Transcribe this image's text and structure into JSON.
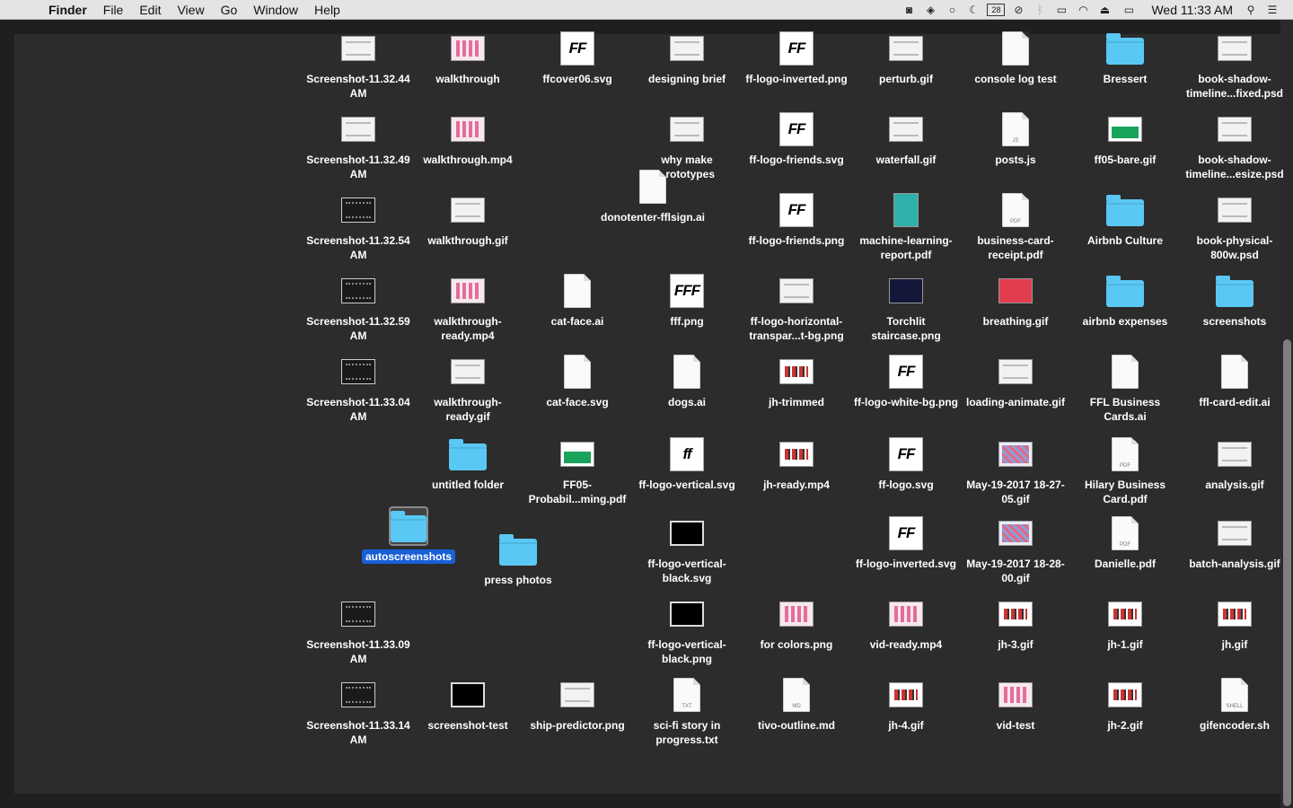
{
  "menubar": {
    "apple": "",
    "app_name": "Finder",
    "menus": [
      "File",
      "Edit",
      "View",
      "Go",
      "Window",
      "Help"
    ],
    "status_icons": [
      "camera-icon",
      "dropbox-icon",
      "record-icon",
      "moon-icon",
      "calendar-icon",
      "block-icon",
      "bluetooth-icon",
      "airplay-icon",
      "wifi-icon",
      "eject-icon",
      "battery-icon"
    ],
    "calendar_day": "28",
    "clock": "Wed 11:33 AM"
  },
  "desktop": {
    "items": [
      {
        "label": "Screenshot-11.32.44 AM",
        "icon": "thumb lined"
      },
      {
        "label": "walkthrough",
        "icon": "thumb pink"
      },
      {
        "label": "ffcover06.svg",
        "icon": "logo",
        "logo": "FF"
      },
      {
        "label": "designing brief",
        "icon": "thumb lined"
      },
      {
        "label": "ff-logo-inverted.png",
        "icon": "logo",
        "logo": "FF"
      },
      {
        "label": "perturb.gif",
        "icon": "thumb lined"
      },
      {
        "label": "console log test",
        "icon": "doc"
      },
      {
        "label": "Bressert",
        "icon": "folder"
      },
      {
        "label": "book-shadow-timeline...fixed.psd",
        "icon": "thumb lined"
      },
      {
        "label": "Screenshot-11.32.49 AM",
        "icon": "thumb lined"
      },
      {
        "label": "walkthrough.mp4",
        "icon": "thumb pink"
      },
      {
        "label": "why make prototypes",
        "icon": "thumb lined"
      },
      {
        "label": "ff-logo-friends.svg",
        "icon": "logo",
        "logo": "FF"
      },
      {
        "label": "waterfall.gif",
        "icon": "thumb lined"
      },
      {
        "label": "posts.js",
        "icon": "doc",
        "tag": "JS"
      },
      {
        "label": "ff05-bare.gif",
        "icon": "thumb green"
      },
      {
        "label": "book-shadow-timeline...esize.psd",
        "icon": "thumb lined"
      },
      {
        "label": "donotenter-fflsign.ai",
        "icon": "doc"
      },
      {
        "label": "Screenshot-11.32.54 AM",
        "icon": "thumb dark"
      },
      {
        "label": "walkthrough.gif",
        "icon": "thumb lined"
      },
      {
        "label": "ff-logo-friends.png",
        "icon": "logo",
        "logo": "FF"
      },
      {
        "label": "machine-learning-report.pdf",
        "icon": "thumb teal"
      },
      {
        "label": "business-card-receipt.pdf",
        "icon": "doc",
        "tag": "PDF"
      },
      {
        "label": "Airbnb Culture",
        "icon": "folder"
      },
      {
        "label": "book-physical-800w.psd",
        "icon": "thumb lined"
      },
      {
        "label": "Screenshot-11.32.59 AM",
        "icon": "thumb dark"
      },
      {
        "label": "walkthrough-ready.mp4",
        "icon": "thumb pink"
      },
      {
        "label": "cat-face.ai",
        "icon": "doc"
      },
      {
        "label": "fff.png",
        "icon": "logo",
        "logo": "FFF"
      },
      {
        "label": "ff-logo-horizontal-transpar...t-bg.png",
        "icon": "thumb lined"
      },
      {
        "label": "Torchlit staircase.png",
        "icon": "thumb navy"
      },
      {
        "label": "breathing.gif",
        "icon": "thumb red"
      },
      {
        "label": "airbnb expenses",
        "icon": "folder"
      },
      {
        "label": "screenshots",
        "icon": "folder"
      },
      {
        "label": "Screenshot-11.33.04 AM",
        "icon": "thumb dark"
      },
      {
        "label": "walkthrough-ready.gif",
        "icon": "thumb lined"
      },
      {
        "label": "cat-face.svg",
        "icon": "doc"
      },
      {
        "label": "dogs.ai",
        "icon": "doc"
      },
      {
        "label": "jh-trimmed",
        "icon": "thumb tiles"
      },
      {
        "label": "ff-logo-white-bg.png",
        "icon": "logo",
        "logo": "FF"
      },
      {
        "label": "loading-animate.gif",
        "icon": "thumb lined"
      },
      {
        "label": "FFL Business Cards.ai",
        "icon": "doc"
      },
      {
        "label": "ffl-card-edit.ai",
        "icon": "doc"
      },
      {
        "label": "untitled folder",
        "icon": "folder"
      },
      {
        "label": "FF05-Probabil...ming.pdf",
        "icon": "thumb green"
      },
      {
        "label": "ff-logo-vertical.svg",
        "icon": "logo",
        "logo": "ff"
      },
      {
        "label": "jh-ready.mp4",
        "icon": "thumb tiles"
      },
      {
        "label": "ff-logo.svg",
        "icon": "logo",
        "logo": "FF"
      },
      {
        "label": "May-19-2017 18-27-05.gif",
        "icon": "thumb pixel"
      },
      {
        "label": "Hilary Business Card.pdf",
        "icon": "doc",
        "tag": "PDF"
      },
      {
        "label": "analysis.gif",
        "icon": "thumb lined"
      },
      {
        "label": "autoscreenshots",
        "icon": "folder",
        "selected": true
      },
      {
        "label": "press photos",
        "icon": "folder"
      },
      {
        "label": "ff-logo-vertical-black.svg",
        "icon": "thumb black"
      },
      {
        "label": "ff-logo-inverted.svg",
        "icon": "logo",
        "logo": "FF"
      },
      {
        "label": "May-19-2017 18-28-00.gif",
        "icon": "thumb pixel"
      },
      {
        "label": "Danielle.pdf",
        "icon": "doc",
        "tag": "PDF"
      },
      {
        "label": "batch-analysis.gif",
        "icon": "thumb lined"
      },
      {
        "label": "Screenshot-11.33.09 AM",
        "icon": "thumb dark"
      },
      {
        "label": "ff-logo-vertical-black.png",
        "icon": "thumb black"
      },
      {
        "label": "for colors.png",
        "icon": "thumb pink"
      },
      {
        "label": "vid-ready.mp4",
        "icon": "thumb pink"
      },
      {
        "label": "jh-3.gif",
        "icon": "thumb tiles"
      },
      {
        "label": "jh-1.gif",
        "icon": "thumb tiles"
      },
      {
        "label": "jh.gif",
        "icon": "thumb tiles"
      },
      {
        "label": "Screenshot-11.33.14 AM",
        "icon": "thumb dark"
      },
      {
        "label": "screenshot-test",
        "icon": "thumb black"
      },
      {
        "label": "ship-predictor.png",
        "icon": "thumb lined"
      },
      {
        "label": "sci-fi story in progress.txt",
        "icon": "doc",
        "tag": "TXT"
      },
      {
        "label": "tivo-outline.md",
        "icon": "doc",
        "tag": "MD"
      },
      {
        "label": "jh-4.gif",
        "icon": "thumb tiles"
      },
      {
        "label": "vid-test",
        "icon": "thumb pink"
      },
      {
        "label": "jh-2.gif",
        "icon": "thumb tiles"
      },
      {
        "label": "gifencoder.sh",
        "icon": "doc",
        "tag": "SHELL"
      }
    ]
  }
}
